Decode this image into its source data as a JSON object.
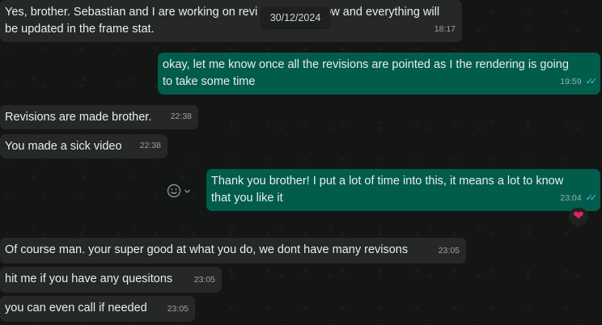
{
  "date_pill": "30/12/2024",
  "messages": [
    {
      "text": "Yes, brother. Sebastian and I are working on revi",
      "text2": "ow and everything will",
      "line2": "be updated in the frame stat.",
      "time": "18:17"
    },
    {
      "text": "okay, let me know once all the revisions are pointed as I the rendering is going",
      "line2": "to take some time",
      "time": "19:59"
    },
    {
      "text": "Revisions are made brother.",
      "time": "22:38"
    },
    {
      "text": "You made a sick video",
      "time": "22:38"
    },
    {
      "text": "Thank you brother! I put a lot of time into this, it means a lot to know",
      "line2": "that you like it",
      "time": "23:04"
    },
    {
      "text": "Of course man. your super good at what you do, we dont have many revisons",
      "time": "23:05"
    },
    {
      "text": "hit me if you have any quesitons",
      "time": "23:05"
    },
    {
      "text": "you can even call if needed",
      "time": "23:05"
    }
  ],
  "reaction": "❤",
  "icons": {
    "react": "emoji-icon",
    "read": "double-check-icon"
  }
}
